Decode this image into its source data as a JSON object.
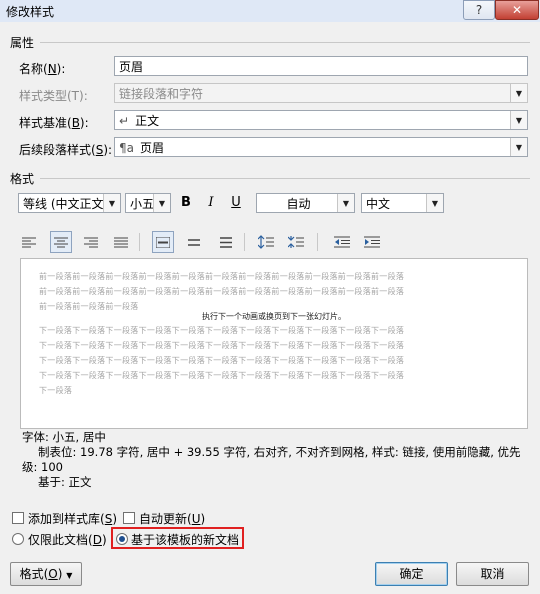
{
  "window": {
    "title": "修改样式",
    "help_label": "?",
    "close_label": "✕"
  },
  "properties": {
    "section_label": "属性",
    "name_label": "名称(",
    "name_key": "N",
    "name_label_end": "):",
    "name_value": "页眉",
    "type_label": "样式类型(T):",
    "type_value": "链接段落和字符",
    "based_label": "样式基准(",
    "based_key": "B",
    "based_label_end": "):",
    "based_glyph": "↵",
    "based_value": "正文",
    "next_label": "后续段落样式(",
    "next_key": "S",
    "next_label_end": "):",
    "next_glyph": "¶a",
    "next_value": "页眉"
  },
  "formatting": {
    "section_label": "格式",
    "font_value": "等线 (中文正文)",
    "size_value": "小五",
    "bold": "B",
    "italic": "I",
    "underline": "U",
    "color_value": "自动",
    "lang_value": "中文"
  },
  "preview": {
    "prev_lines": [
      "前一段落前一段落前一段落前一段落前一段落前一段落前一段落前一段落前一段落前一段落前一段落",
      "前一段落前一段落前一段落前一段落前一段落前一段落前一段落前一段落前一段落前一段落前一段落",
      "前一段落前一段落前一段落"
    ],
    "current_line": "执行下一个动画或换页到下一张幻灯片。",
    "next_lines": [
      "下一段落下一段落下一段落下一段落下一段落下一段落下一段落下一段落下一段落下一段落下一段落",
      "下一段落下一段落下一段落下一段落下一段落下一段落下一段落下一段落下一段落下一段落下一段落",
      "下一段落下一段落下一段落下一段落下一段落下一段落下一段落下一段落下一段落下一段落下一段落",
      "下一段落下一段落下一段落下一段落下一段落下一段落下一段落下一段落下一段落下一段落下一段落",
      "下一段落"
    ]
  },
  "description": {
    "line1": "字体: 小五, 居中",
    "line2": "制表位: 19.78 字符, 居中 +  39.55 字符, 右对齐, 不对齐到网格, 样式: 链接, 使用前隐藏, 优先",
    "line3": "级: 100",
    "line4": "基于: 正文"
  },
  "options": {
    "add_gallery_label": "添加到样式库(",
    "add_gallery_key": "S",
    "add_gallery_end": ")",
    "auto_update_label": "自动更新(",
    "auto_update_key": "U",
    "auto_update_end": ")",
    "only_doc_label": "仅限此文档(",
    "only_doc_key": "D",
    "only_doc_end": ")",
    "template_label": "基于该模板的新文档"
  },
  "buttons": {
    "format_label": "格式(",
    "format_key": "O",
    "format_end": ")",
    "ok_label": "确定",
    "cancel_label": "取消"
  },
  "colors": {
    "highlight": "#e02020",
    "accent": "#1f4f8f"
  }
}
